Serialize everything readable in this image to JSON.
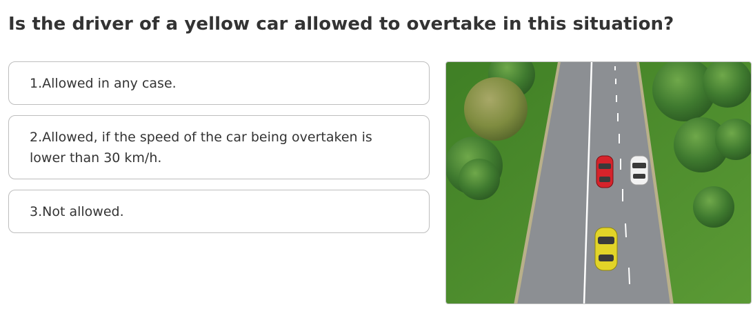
{
  "question": {
    "text": "Is the driver of a yellow car allowed to overtake in this situation?"
  },
  "answers": [
    {
      "label": "1.Allowed in any case."
    },
    {
      "label": "2.Allowed, if the speed of the car being overtaken is lower than 30 km/h."
    },
    {
      "label": "3.Not allowed."
    }
  ],
  "scene": {
    "colors": {
      "grass": "#4a8a2c",
      "road": "#8c8f93",
      "marking": "#ffffff",
      "yellow_car": "#e2d428",
      "red_car": "#d6232b",
      "white_car": "#f2f2f2",
      "tree": "#3f7a2f",
      "tree_light": "#8c9a4a"
    },
    "icons": [
      "tree-icon",
      "car-icon"
    ]
  }
}
